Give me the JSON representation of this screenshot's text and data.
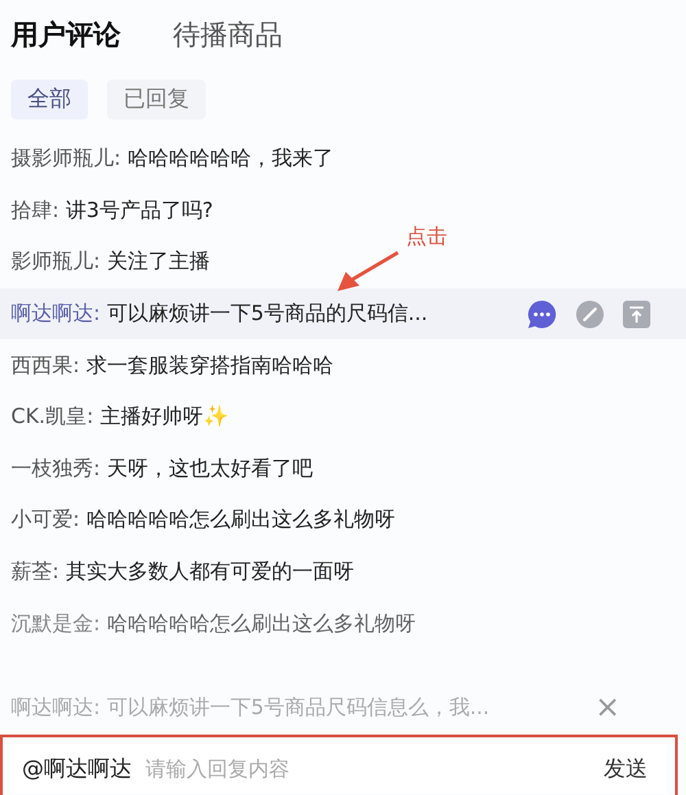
{
  "tabs": [
    {
      "label": "用户评论",
      "selected": true
    },
    {
      "label": "待播商品",
      "selected": false
    }
  ],
  "filters": [
    {
      "label": "全部",
      "selected": true
    },
    {
      "label": "已回复",
      "selected": false
    }
  ],
  "comments": [
    {
      "user": "摄影师瓶儿:",
      "text": "哈哈哈哈哈哈，我来了",
      "selected": false
    },
    {
      "user": "拾肆:",
      "text": "讲3号产品了吗?",
      "selected": false
    },
    {
      "user": "影师瓶儿:",
      "text": "关注了主播",
      "selected": false
    },
    {
      "user": "啊达啊达:",
      "text": "可以麻烦讲一下5号商品的尺码信...",
      "selected": true
    },
    {
      "user": "西西果:",
      "text": "求一套服装穿搭指南哈哈哈",
      "selected": false
    },
    {
      "user": "CK.凯皇:",
      "text": "主播好帅呀✨",
      "selected": false
    },
    {
      "user": "一枝独秀:",
      "text": "天呀，这也太好看了吧",
      "selected": false
    },
    {
      "user": "小可爱:",
      "text": "哈哈哈哈哈怎么刷出这么多礼物呀",
      "selected": false
    },
    {
      "user": "薪荃:",
      "text": "其实大多数人都有可爱的一面呀",
      "selected": false
    },
    {
      "user": "沉默是金:",
      "text": "哈哈哈哈哈怎么刷出这么多礼物呀",
      "selected": false
    }
  ],
  "annotation": {
    "label": "点击"
  },
  "reply_preview": {
    "user": "啊达啊达:",
    "text": "可以麻烦讲一下5号商品尺码信息么，我...",
    "close": "×"
  },
  "reply_box": {
    "mention": "@啊达啊达",
    "placeholder": "请输入回复内容",
    "send": "发送"
  }
}
